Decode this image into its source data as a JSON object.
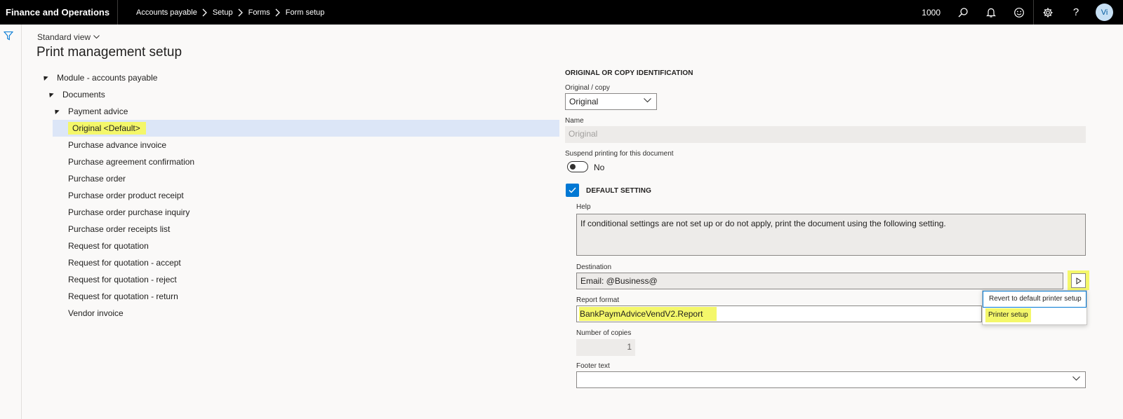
{
  "app": {
    "title": "Finance and Operations"
  },
  "breadcrumb": [
    "Accounts payable",
    "Setup",
    "Forms",
    "Form setup"
  ],
  "topbar": {
    "company": "1000",
    "avatar_initials": "Vi"
  },
  "header": {
    "view": "Standard view",
    "title": "Print management setup"
  },
  "tree": {
    "module": "Module - accounts payable",
    "documents": "Documents",
    "payment_advice": "Payment advice",
    "selected": "Original <Default>",
    "items": [
      "Purchase advance invoice",
      "Purchase agreement confirmation",
      "Purchase order",
      "Purchase order product receipt",
      "Purchase order purchase inquiry",
      "Purchase order receipts list",
      "Request for quotation",
      "Request for quotation - accept",
      "Request for quotation - reject",
      "Request for quotation - return",
      "Vendor invoice"
    ]
  },
  "form": {
    "section_title": "ORIGINAL OR COPY IDENTIFICATION",
    "original_copy_label": "Original / copy",
    "original_copy_value": "Original",
    "name_label": "Name",
    "name_value": "Original",
    "suspend_label": "Suspend printing for this document",
    "suspend_value": "No",
    "default_setting_label": "DEFAULT SETTING",
    "help_label": "Help",
    "help_text": "If conditional settings are not set up or do not apply, print the document using the following setting.",
    "destination_label": "Destination",
    "destination_value": "Email: @Business@",
    "report_format_label": "Report format",
    "report_format_value": "BankPaymAdviceVendV2.Report",
    "copies_label": "Number of copies",
    "copies_value": "1",
    "footer_label": "Footer text",
    "footer_value": ""
  },
  "destination_menu": {
    "items": [
      "Revert to default printer setup",
      "Printer setup"
    ]
  },
  "colors": {
    "highlight": "#f4f76a",
    "accent": "#0078d4",
    "selected_row": "#dce6f7",
    "topbar": "#000000"
  }
}
